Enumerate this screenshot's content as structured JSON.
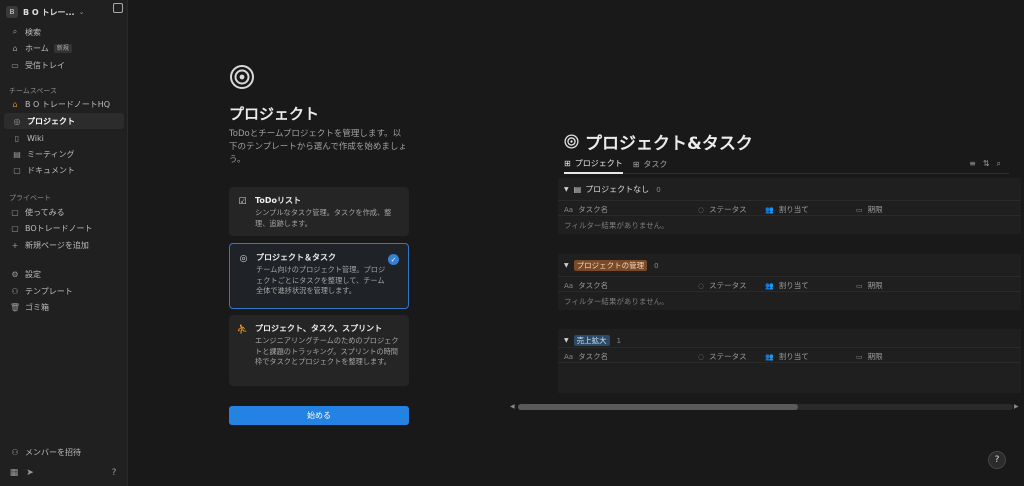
{
  "sidebar": {
    "workspace_name": "B O トレー...",
    "workspace_initial": "B",
    "top_items": [
      {
        "label": "検索",
        "icon": "search-icon"
      },
      {
        "label": "ホーム",
        "icon": "home-icon",
        "badge": "新規"
      },
      {
        "label": "受信トレイ",
        "icon": "inbox-icon"
      }
    ],
    "teamspace_label": "チームスペース",
    "team_items": [
      {
        "label": "B O トレードノートHQ",
        "icon": "home-icon"
      },
      {
        "label": "プロジェクト",
        "icon": "target-icon"
      },
      {
        "label": "Wiki",
        "icon": "book-icon"
      },
      {
        "label": "ミーティング",
        "icon": "calendar-icon"
      },
      {
        "label": "ドキュメント",
        "icon": "document-icon"
      }
    ],
    "private_label": "プライベート",
    "private_items": [
      {
        "label": "使ってみる",
        "icon": "page-icon"
      },
      {
        "label": "BOトレードノート",
        "icon": "page-icon"
      },
      {
        "label": "新規ページを追加",
        "icon": "plus-icon"
      }
    ],
    "util_items": [
      {
        "label": "設定",
        "icon": "gear-icon"
      },
      {
        "label": "テンプレート",
        "icon": "template-icon"
      },
      {
        "label": "ゴミ箱",
        "icon": "trash-icon"
      }
    ],
    "invite_label": "メンバーを招待"
  },
  "template_picker": {
    "heading": "プロジェクト",
    "description": "ToDoとチームプロジェクトを管理します。以下のテンプレートから選んで作成を始めましょう。",
    "options": [
      {
        "title": "ToDoリスト",
        "desc": "シンプルなタスク管理。タスクを作成、整理、追跡します。"
      },
      {
        "title": "プロジェクト＆タスク",
        "desc": "チーム向けのプロジェクト管理。プロジェクトごとにタスクを整理して、チーム全体で進捗状況を管理します。"
      },
      {
        "title": "プロジェクト、タスク、スプリント",
        "desc": "エンジニアリングチームのためのプロジェクトと課題のトラッキング。スプリントの時間枠でタスクとプロジェクトを整理します。"
      }
    ],
    "start_label": "始める"
  },
  "preview": {
    "title": "プロジェクト&タスク",
    "tabs": [
      "プロジェクト",
      "タスク"
    ],
    "columns": [
      "タスク名",
      "ステータス",
      "割り当て",
      "期限"
    ],
    "col_icons": [
      "Aa",
      "◌",
      "👥",
      "▭"
    ],
    "empty_text": "フィルター結果がありません。",
    "groups": [
      {
        "label": "プロジェクトなし",
        "count": "0"
      },
      {
        "label": "プロジェクトの管理",
        "count": "0"
      },
      {
        "label": "売上拡大",
        "count": "1"
      }
    ]
  },
  "colors": {
    "accent": "#2483e2",
    "selected_border": "#2f78c9",
    "tag_brown": "#7a4a26",
    "tag_blue": "#2a4a66"
  }
}
